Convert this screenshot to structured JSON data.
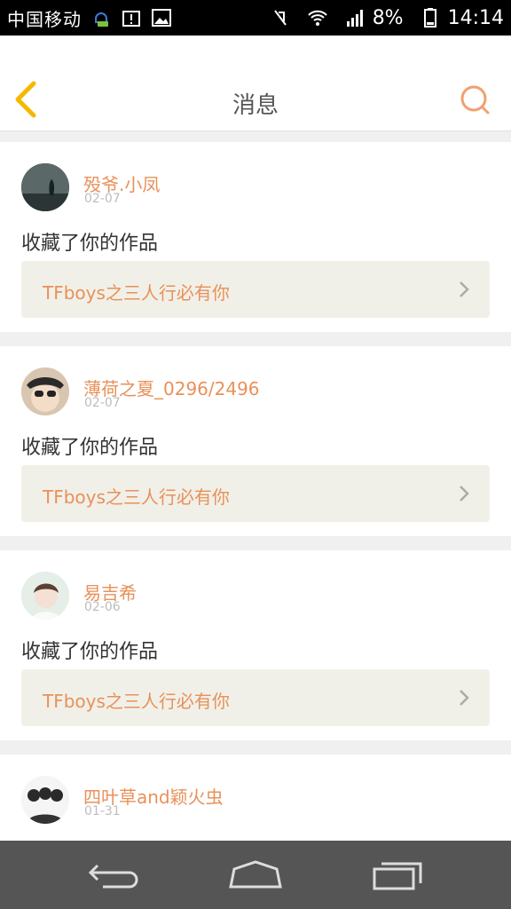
{
  "status_bar": {
    "carrier": "中国移动",
    "battery_percent": "8%",
    "time": "14:14",
    "icons": [
      "voicemail-icon",
      "alert-icon",
      "image-icon",
      "mute-icon",
      "wifi-icon",
      "signal-icon",
      "battery-icon"
    ]
  },
  "header": {
    "title": "消息",
    "back_icon": "back-chevron-icon",
    "search_icon": "search-icon"
  },
  "messages": [
    {
      "username": "殁爷.小凤",
      "date": "02-07",
      "action": "收藏了你的作品",
      "work_title": "TFboys之三人行必有你"
    },
    {
      "username": "薄荷之夏_0296/2496",
      "date": "02-07",
      "action": "收藏了你的作品",
      "work_title": "TFboys之三人行必有你"
    },
    {
      "username": "易吉希",
      "date": "02-06",
      "action": "收藏了你的作品",
      "work_title": "TFboys之三人行必有你"
    },
    {
      "username": "四叶草and颖火虫",
      "date": "01-31",
      "action": "",
      "work_title": ""
    }
  ],
  "colors": {
    "accent": "#e8915a",
    "back_chevron": "#f5b800",
    "work_bg": "#f1f0e8",
    "navbar_bg": "#555555"
  },
  "nav_bar": [
    "back-nav-icon",
    "home-nav-icon",
    "recents-nav-icon"
  ]
}
